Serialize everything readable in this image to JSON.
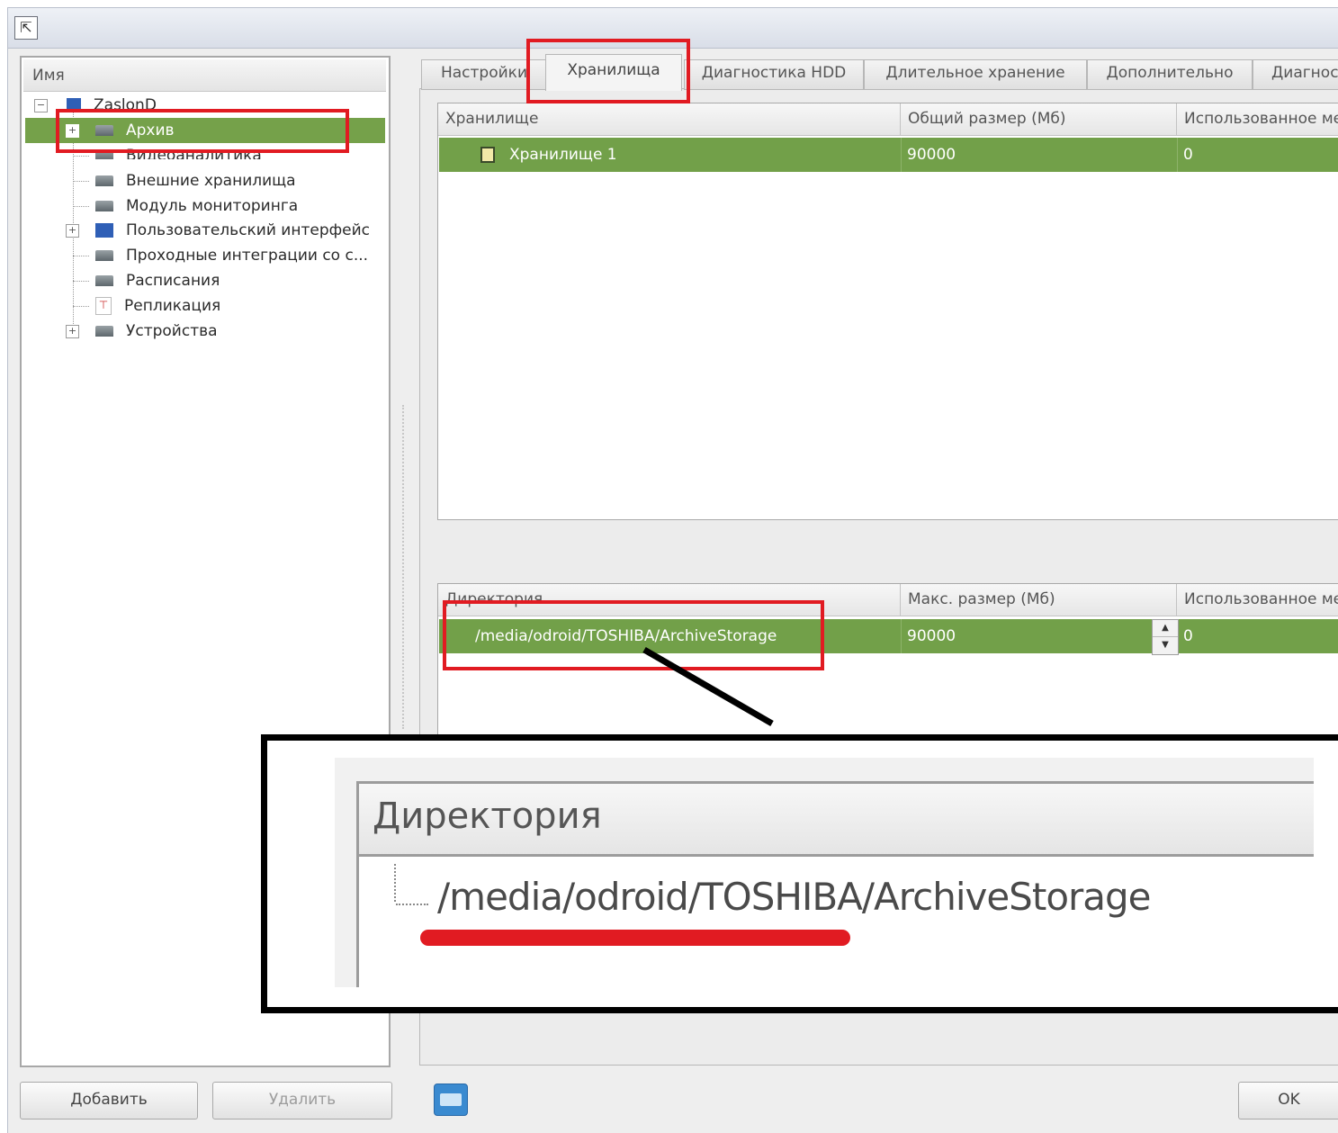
{
  "window": {
    "title_icon": "app-icon"
  },
  "tree": {
    "header": "Имя",
    "root": "ZaslonD",
    "items": [
      {
        "label": "Архив",
        "icon": "storage-icon",
        "selected": true,
        "expandable": true
      },
      {
        "label": "Видеоаналитика",
        "icon": "storage-icon"
      },
      {
        "label": "Внешние хранилища",
        "icon": "storage-icon"
      },
      {
        "label": "Модуль мониторинга",
        "icon": "storage-icon"
      },
      {
        "label": "Пользовательский интерфейс",
        "icon": "monitor-icon",
        "expandable": true
      },
      {
        "label": "Проходные интеграции со с...",
        "icon": "storage-icon"
      },
      {
        "label": "Расписания",
        "icon": "storage-icon"
      },
      {
        "label": "Репликация",
        "icon": "replication-icon"
      },
      {
        "label": "Устройства",
        "icon": "storage-icon",
        "expandable": true
      }
    ]
  },
  "tabs": [
    {
      "label": "Настройки"
    },
    {
      "label": "Хранилища",
      "active": true
    },
    {
      "label": "Диагностика HDD"
    },
    {
      "label": "Длительное хранение"
    },
    {
      "label": "Дополнительно"
    },
    {
      "label": "Диагнос"
    }
  ],
  "storage_table": {
    "columns": [
      "Хранилище",
      "Общий размер (Мб)",
      "Использованное ме"
    ],
    "rows": [
      {
        "name": "Хранилище 1",
        "total": "90000",
        "used": "0"
      }
    ]
  },
  "directory_table": {
    "columns": [
      "Директория",
      "Макс. размер (Мб)",
      "Использованное ме"
    ],
    "rows": [
      {
        "path": "/media/odroid/TOSHIBA/ArchiveStorage",
        "max": "90000",
        "used": "0"
      }
    ]
  },
  "zoom": {
    "header": "Директория",
    "path": "/media/odroid/TOSHIBA/ArchiveStorage"
  },
  "buttons": {
    "add": "Добавить",
    "delete": "Удалить",
    "ok": "OK"
  },
  "colors": {
    "selection": "#72a049",
    "annotation": "#e11b22"
  }
}
